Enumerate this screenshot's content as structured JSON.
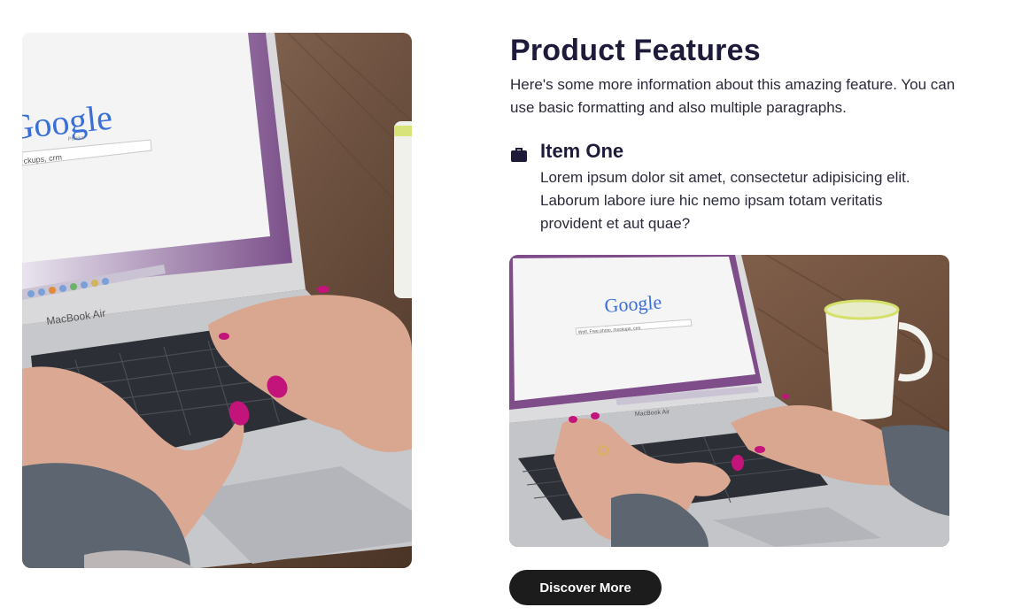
{
  "section": {
    "title": "Product Features",
    "intro": "Here's some more information about this amazing feature. You can use basic formatting and also multiple paragraphs."
  },
  "feature": {
    "icon": "briefcase-icon",
    "title": "Item One",
    "text": "Lorem ipsum dolor sit amet, consectetur adipisicing elit. Laborum labore iure hic nemo ipsam totam veritatis provident et aut quae?"
  },
  "cta": {
    "label": "Discover More"
  },
  "photo": {
    "description": "hands typing on a laptop on a wooden desk",
    "laptop_label": "MacBook Air",
    "search_brand": "Google",
    "search_country": "Polska",
    "search_query_big": "ckups, crm",
    "search_query_small": "Wolf, Free photo, mockups, crm"
  },
  "colors": {
    "heading": "#1e1b3a",
    "button_bg": "#1c1c1c",
    "button_text": "#ffffff",
    "nail": "#c2147a",
    "sweater": "#5a6470",
    "desk": "#7a5a44"
  }
}
